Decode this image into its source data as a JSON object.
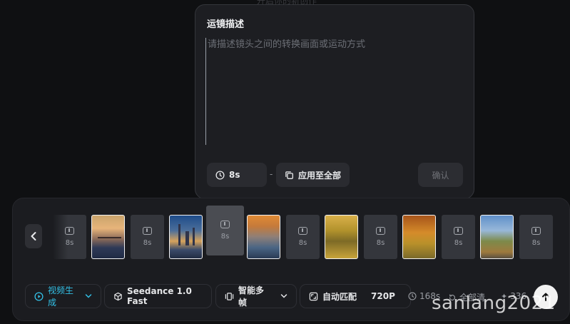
{
  "background_title": "开启你的新创作",
  "popup": {
    "title": "运镜描述",
    "placeholder": "请描述镜头之间的转换画面或运动方式",
    "duration": "8s",
    "dash": "-",
    "apply_all": "应用至全部",
    "confirm": "确认"
  },
  "strip": {
    "prev_icon": "chevron-left-icon",
    "items": [
      {
        "kind": "slot",
        "duration": "8s"
      },
      {
        "kind": "image",
        "alt": "sunset pier"
      },
      {
        "kind": "slot",
        "duration": "8s"
      },
      {
        "kind": "image",
        "alt": "city skyline"
      },
      {
        "kind": "slot",
        "duration": "8s"
      },
      {
        "kind": "image",
        "alt": "mountain mist"
      },
      {
        "kind": "slot",
        "duration": "8s"
      },
      {
        "kind": "image",
        "alt": "golden forest"
      },
      {
        "kind": "slot",
        "duration": "8s"
      },
      {
        "kind": "image",
        "alt": "autumn tree"
      },
      {
        "kind": "slot",
        "duration": "8s"
      },
      {
        "kind": "image",
        "alt": "hillside path"
      },
      {
        "kind": "slot",
        "duration": "8s"
      }
    ]
  },
  "toolbar": {
    "video_gen": "视频生成",
    "model": "Seedance 1.0 Fast",
    "frames": "智能多帧",
    "match": "自动匹配",
    "resolution": "720P",
    "total_time": "168s",
    "reset": "全部清",
    "credits": "336"
  },
  "watermark": "sanlang2021",
  "colors": {
    "accent": "#33c0e6",
    "panel": "#1b1c20",
    "popup": "#1d1e22"
  }
}
